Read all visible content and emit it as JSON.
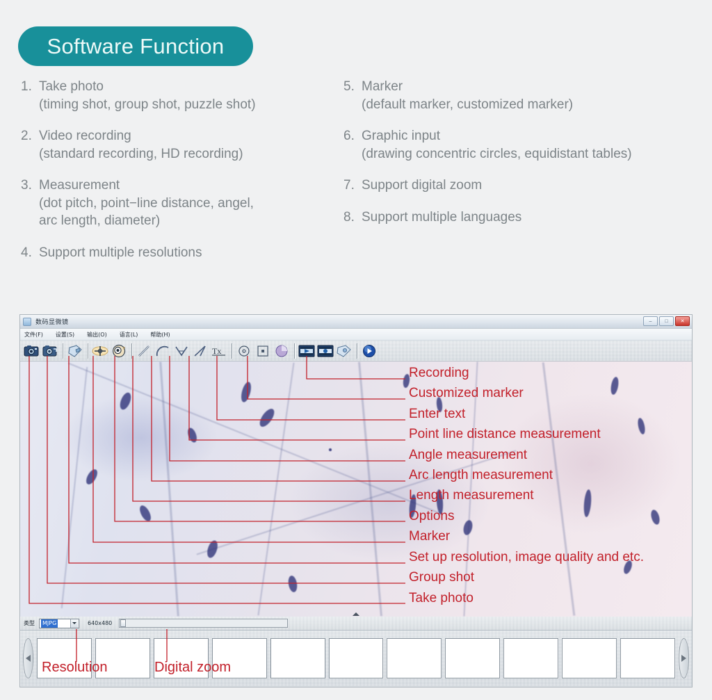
{
  "header": {
    "title": "Software Function",
    "pill_color": "#18909a"
  },
  "features": {
    "left": [
      {
        "num": "1.",
        "title": "Take photo",
        "sub": "(timing shot, group shot, puzzle shot)"
      },
      {
        "num": "2.",
        "title": "Video recording",
        "sub": "(standard recording, HD recording)"
      },
      {
        "num": "3.",
        "title": "Measurement",
        "sub": "(dot pitch, point−line distance, angel,",
        "sub2": "arc length, diameter)"
      },
      {
        "num": "4.",
        "title": "Support multiple resolutions",
        "sub": ""
      }
    ],
    "right": [
      {
        "num": "5.",
        "title": "Marker",
        "sub": "(default marker, customized marker)"
      },
      {
        "num": "6.",
        "title": "Graphic input",
        "sub": "(drawing concentric circles, equidistant tables)"
      },
      {
        "num": "7.",
        "title": "Support digital zoom",
        "sub": ""
      },
      {
        "num": "8.",
        "title": "Support multiple languages",
        "sub": ""
      }
    ]
  },
  "app": {
    "title": "数码显微镜",
    "window_buttons": [
      {
        "name": "minimize",
        "glyph": "–"
      },
      {
        "name": "maximize",
        "glyph": "□"
      },
      {
        "name": "close",
        "glyph": "✕"
      }
    ],
    "menu": [
      "文件(F)",
      "设置(S)",
      "输出(O)",
      "语言(L)",
      "帮助(H)"
    ],
    "toolbar": [
      {
        "name": "take-photo-icon",
        "label": "Take photo"
      },
      {
        "name": "group-shot-icon",
        "label": "Group shot"
      },
      {
        "name": "set-up-resolution-icon",
        "label": "Set up resolution, image quality and etc."
      },
      {
        "name": "marker-icon",
        "label": "Marker"
      },
      {
        "name": "options-icon",
        "label": "Options"
      },
      {
        "name": "length-measurement-icon",
        "label": "Length measurement"
      },
      {
        "name": "arc-length-measurement-icon",
        "label": "Arc length measurement"
      },
      {
        "name": "angle-measurement-icon",
        "label": "Angle measurement"
      },
      {
        "name": "point-line-distance-icon",
        "label": "Point line distance measurement"
      },
      {
        "name": "enter-text-icon",
        "label": "Enter text"
      },
      {
        "name": "default-marker-icon",
        "label": "Default marker"
      },
      {
        "name": "customized-marker-icon",
        "label": "Customized marker"
      },
      {
        "name": "concentric-circles-icon",
        "label": "Concentric circles"
      },
      {
        "name": "recording-icon",
        "label": "Recording"
      },
      {
        "name": "hd-recording-icon",
        "label": "HD recording"
      },
      {
        "name": "snapshot-folder-icon",
        "label": "Snapshot folder"
      },
      {
        "name": "play-icon",
        "label": "Play"
      }
    ],
    "status": {
      "type_label": "类型",
      "type_value": "MJPG",
      "resolution_text": "640x480",
      "zoom_value": 0
    }
  },
  "annotations": {
    "right_labels": [
      "Recording",
      "Customized marker",
      "Enter text",
      "Point line distance measurement",
      "Angle measurement",
      "Arc length measurement",
      "Length measurement",
      "Options",
      "Marker",
      "Set up resolution, image quality and etc.",
      "Group shot",
      "Take photo"
    ],
    "bottom_labels": [
      "Resolution",
      "Digital zoom"
    ],
    "line_color": "#c2202a"
  }
}
